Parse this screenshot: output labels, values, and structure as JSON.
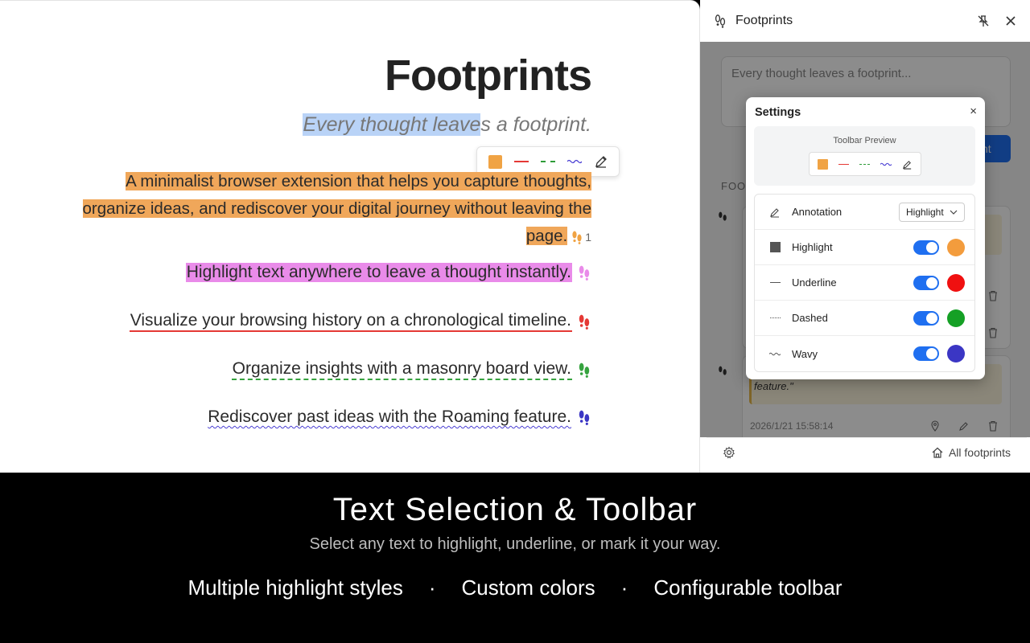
{
  "page": {
    "title": "Footprints",
    "subtitle_selected": "Every thought leave",
    "subtitle_rest": "s a footprint.",
    "paragraph": "A minimalist browser extension that helps you capture thoughts, organize ideas, and rediscover your digital journey without leaving the page.",
    "paragraph_count": "1",
    "features": [
      "Highlight text anywhere to leave a thought instantly.",
      "Visualize your browsing history on a chronological timeline.",
      "Organize insights with a masonry board view.",
      "Rediscover past ideas with the Roaming feature."
    ]
  },
  "panel": {
    "title": "Footprints",
    "compose_placeholder": "Every thought leaves a footprint...",
    "submit_partial": "nt",
    "section_label": "FOO",
    "card2_quote_partial": "feature.\"",
    "card2_timestamp": "2026/1/21 15:58:14",
    "all_footprints_label": "All footprints"
  },
  "settings": {
    "title": "Settings",
    "close": "×",
    "preview_label": "Toolbar Preview",
    "rows": [
      {
        "label": "Annotation",
        "select_value": "Highlight"
      },
      {
        "label": "Highlight",
        "color": "#f39c3d"
      },
      {
        "label": "Underline",
        "color": "#f01010"
      },
      {
        "label": "Dashed",
        "color": "#15a025"
      },
      {
        "label": "Wavy",
        "color": "#3b36c4"
      }
    ]
  },
  "band": {
    "title": "Text Selection & Toolbar",
    "subtitle": "Select any text to highlight, underline, or mark it your way.",
    "features": [
      "Multiple highlight styles",
      "Custom colors",
      "Configurable toolbar"
    ],
    "separator": "·"
  },
  "colors": {
    "accent": "#1f6ff0",
    "highlight_orange": "#f0a75a",
    "highlight_pink": "#e98be9",
    "underline_red": "#e53935",
    "dashed_green": "#36a33f",
    "wavy_blue": "#4a3fd4"
  }
}
